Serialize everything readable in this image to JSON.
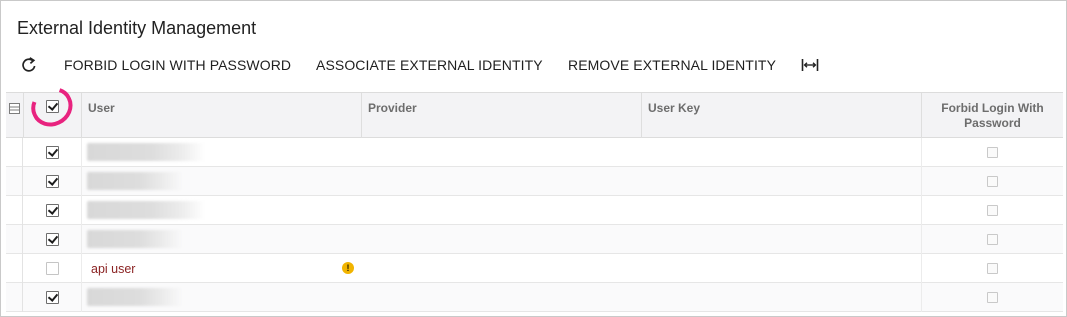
{
  "panel": {
    "title": "External Identity Management"
  },
  "toolbar": {
    "refresh_icon": "refresh-icon",
    "forbid_login_label": "FORBID LOGIN WITH PASSWORD",
    "associate_label": "ASSOCIATE EXTERNAL IDENTITY",
    "remove_label": "REMOVE EXTERNAL IDENTITY",
    "fit_icon": "fit-columns-icon"
  },
  "grid": {
    "columns": {
      "user": "User",
      "provider": "Provider",
      "user_key": "User Key",
      "forbid_line1": "Forbid Login With",
      "forbid_line2": "Password"
    },
    "select_all_checked": true,
    "rows": [
      {
        "selected": true,
        "user": "",
        "user_redacted": true,
        "provider": "",
        "user_key": "",
        "forbid_login": false
      },
      {
        "selected": true,
        "user": "",
        "user_redacted": true,
        "provider": "",
        "user_key": "",
        "forbid_login": false
      },
      {
        "selected": true,
        "user": "",
        "user_redacted": true,
        "provider": "",
        "user_key": "",
        "forbid_login": false
      },
      {
        "selected": true,
        "user": "",
        "user_redacted": true,
        "provider": "",
        "user_key": "",
        "forbid_login": false
      },
      {
        "selected": false,
        "user": "api user",
        "user_redacted": false,
        "warning": true,
        "warning_icon": "warning-icon",
        "provider": "",
        "user_key": "",
        "forbid_login": false
      },
      {
        "selected": true,
        "user": "",
        "user_redacted": true,
        "provider": "",
        "user_key": "",
        "forbid_login": false
      }
    ]
  },
  "colors": {
    "link_red": "#8b2323",
    "warning_yellow": "#f1b400",
    "highlight_pink": "#e8237f"
  }
}
